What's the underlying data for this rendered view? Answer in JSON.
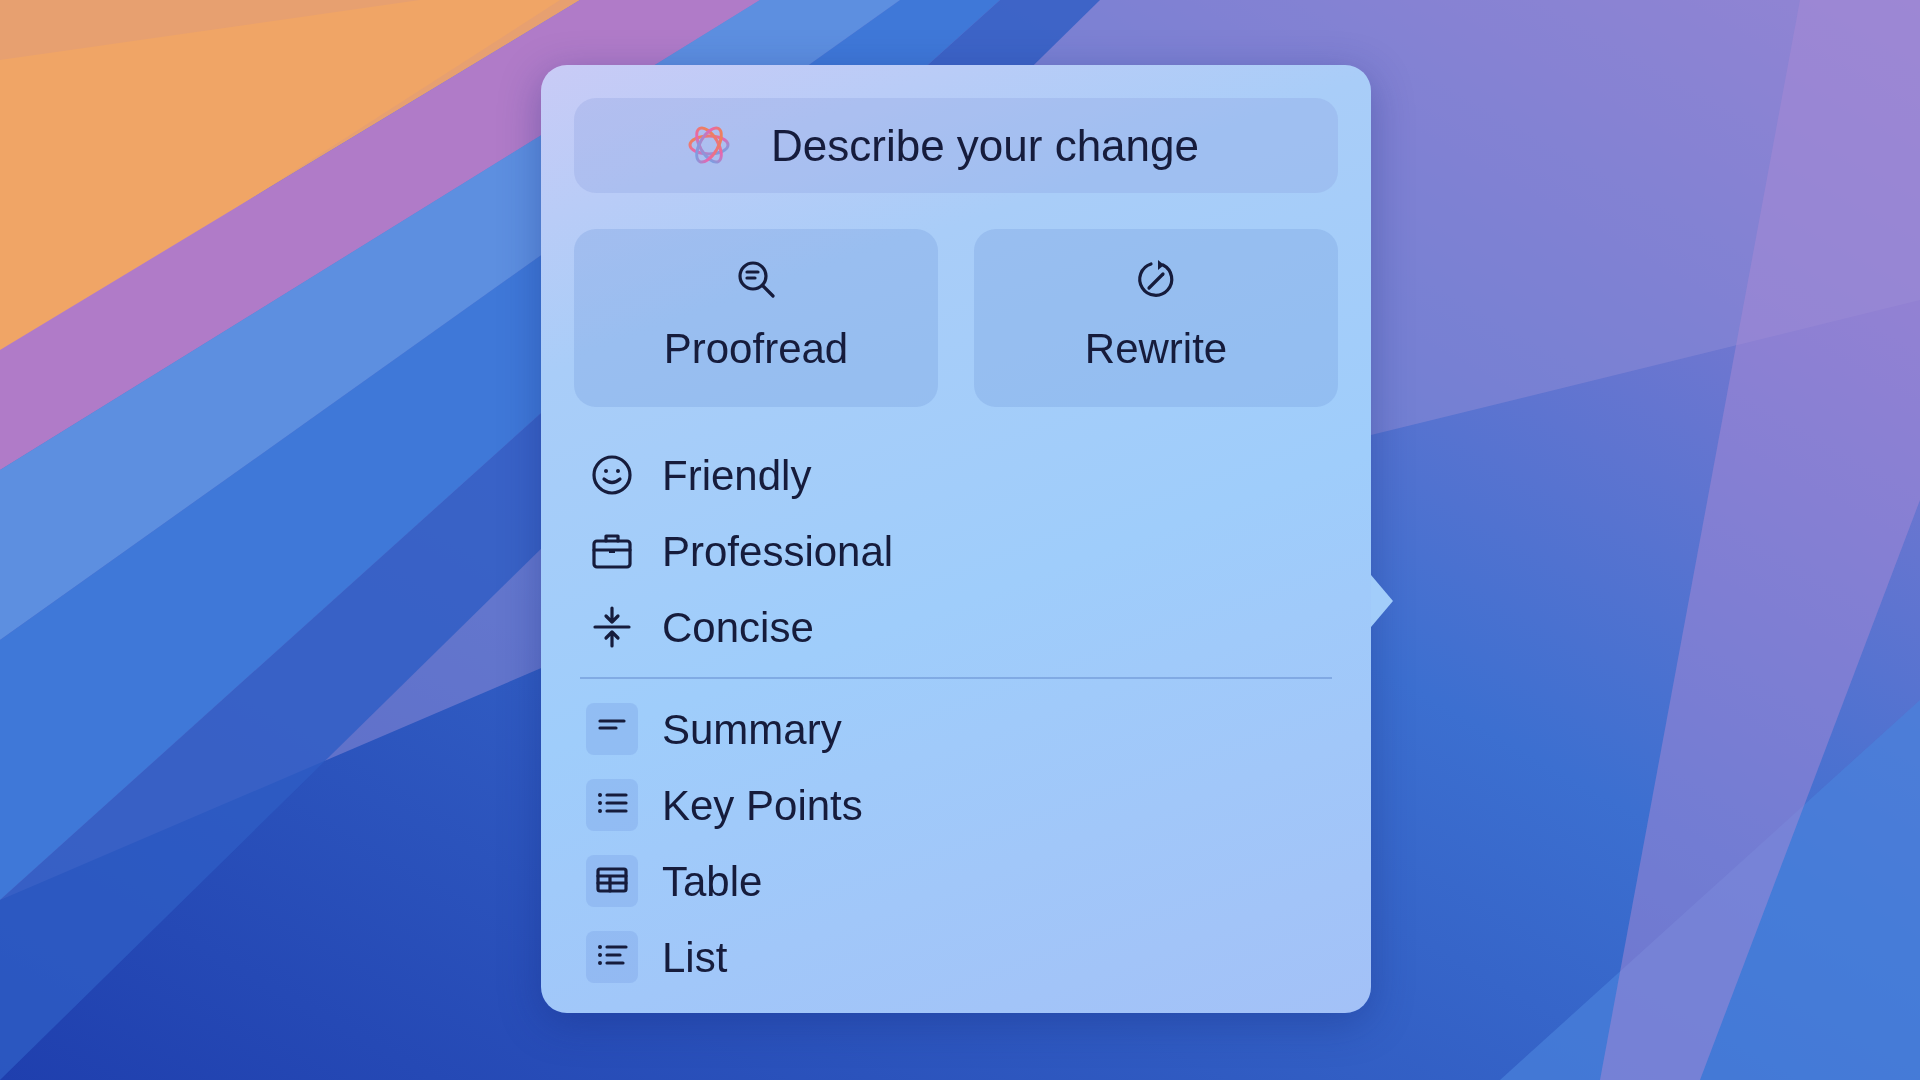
{
  "prompt_field": {
    "placeholder": "Describe your change"
  },
  "actions": [
    {
      "label": "Proofread"
    },
    {
      "label": "Rewrite"
    }
  ],
  "tones": [
    {
      "label": "Friendly"
    },
    {
      "label": "Professional"
    },
    {
      "label": "Concise"
    }
  ],
  "formats": [
    {
      "label": "Summary"
    },
    {
      "label": "Key Points"
    },
    {
      "label": "Table"
    },
    {
      "label": "List"
    }
  ]
}
